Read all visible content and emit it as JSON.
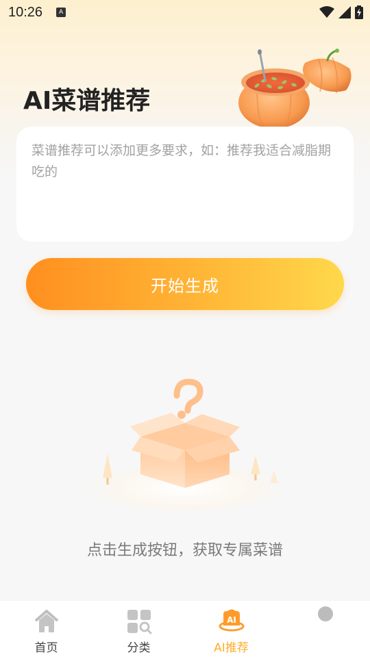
{
  "status_bar": {
    "time": "10:26",
    "notification_icon": "a-icon",
    "icons": [
      "wifi-icon",
      "signal-icon",
      "battery-charging-icon"
    ]
  },
  "page": {
    "title": "AI菜谱推荐",
    "hero_image": "pumpkin-soup-illustration"
  },
  "input": {
    "placeholder": "菜谱推荐可以添加更多要求，如：推荐我适合减脂期吃的",
    "value": ""
  },
  "start_button": {
    "label": "开始生成"
  },
  "empty_state": {
    "illustration": "open-box-question-illustration",
    "text": "点击生成按钮，获取专属菜谱"
  },
  "tabbar": {
    "items": [
      {
        "label": "首页",
        "icon": "home-icon",
        "active": false
      },
      {
        "label": "分类",
        "icon": "category-search-icon",
        "active": false
      },
      {
        "label": "AI推荐",
        "icon": "ai-chef-icon",
        "active": true
      },
      {
        "label": "",
        "icon": "face-icon",
        "active": false
      }
    ]
  },
  "colors": {
    "accent": "#ffac2a",
    "button_gradient_start": "#ff8f1f",
    "button_gradient_end": "#ffd84b",
    "title": "#222222",
    "muted_text": "#7a7a7a"
  }
}
